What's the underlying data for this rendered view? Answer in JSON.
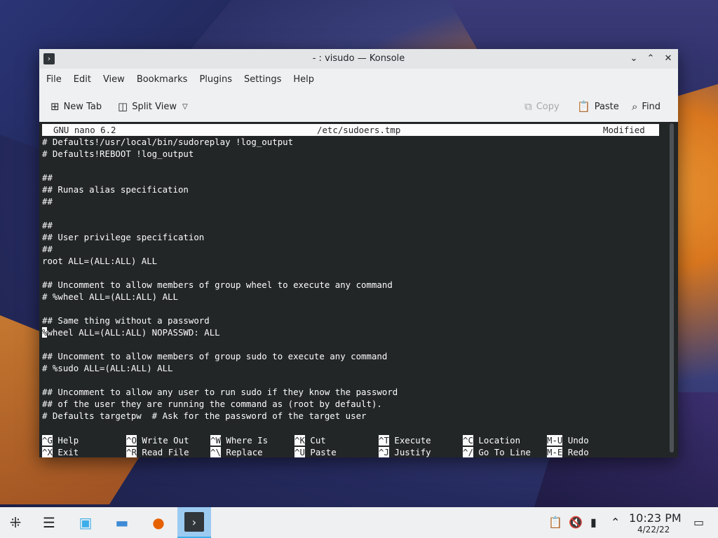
{
  "window": {
    "title": "- : visudo — Konsole",
    "controls": {
      "minimize": "⌄",
      "maximize": "⌃",
      "close": "✕"
    }
  },
  "menu": [
    "File",
    "Edit",
    "View",
    "Bookmarks",
    "Plugins",
    "Settings",
    "Help"
  ],
  "toolbar": {
    "new_tab": "New Tab",
    "split_view": "Split View",
    "copy": "Copy",
    "paste": "Paste",
    "find": "Find"
  },
  "nano": {
    "version": "GNU nano 6.2",
    "filename": "/etc/sudoers.tmp",
    "status": "Modified",
    "lines": [
      "# Defaults!/usr/local/bin/sudoreplay !log_output",
      "# Defaults!REBOOT !log_output",
      "",
      "##",
      "## Runas alias specification",
      "##",
      "",
      "##",
      "## User privilege specification",
      "##",
      "root ALL=(ALL:ALL) ALL",
      "",
      "## Uncomment to allow members of group wheel to execute any command",
      "# %wheel ALL=(ALL:ALL) ALL",
      "",
      "## Same thing without a password",
      "wheel ALL=(ALL:ALL) NOPASSWD: ALL",
      "",
      "## Uncomment to allow members of group sudo to execute any command",
      "# %sudo ALL=(ALL:ALL) ALL",
      "",
      "## Uncomment to allow any user to run sudo if they know the password",
      "## of the user they are running the command as (root by default).",
      "# Defaults targetpw  # Ask for the password of the target user"
    ],
    "cursor_char": "%",
    "shortcuts_row1": [
      {
        "key": "^G",
        "label": "Help"
      },
      {
        "key": "^O",
        "label": "Write Out"
      },
      {
        "key": "^W",
        "label": "Where Is"
      },
      {
        "key": "^K",
        "label": "Cut"
      },
      {
        "key": "^T",
        "label": "Execute"
      },
      {
        "key": "^C",
        "label": "Location"
      },
      {
        "key": "M-U",
        "label": "Undo"
      }
    ],
    "shortcuts_row2": [
      {
        "key": "^X",
        "label": "Exit"
      },
      {
        "key": "^R",
        "label": "Read File"
      },
      {
        "key": "^\\",
        "label": "Replace"
      },
      {
        "key": "^U",
        "label": "Paste"
      },
      {
        "key": "^J",
        "label": "Justify"
      },
      {
        "key": "^/",
        "label": "Go To Line"
      },
      {
        "key": "M-E",
        "label": "Redo"
      }
    ]
  },
  "taskbar": {
    "clock_time": "10:23 PM",
    "clock_date": "4/22/22"
  }
}
